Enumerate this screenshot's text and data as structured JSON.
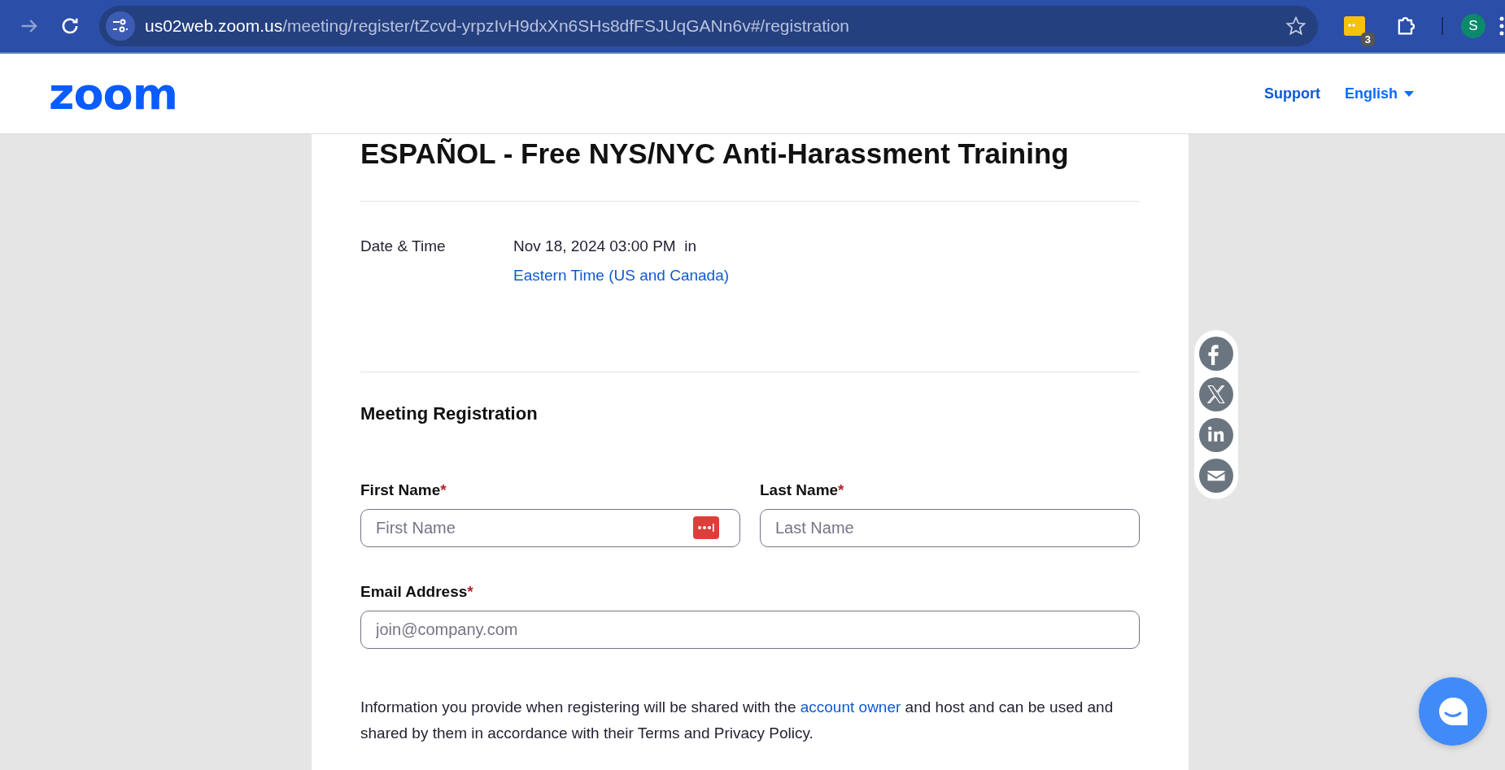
{
  "browser": {
    "url_host": "us02web.zoom.us",
    "url_path": "/meeting/register/tZcvd-yrpzIvH9dxXn6SHs8dfFSJUqGANn6v#/registration",
    "extension_badge": "3",
    "profile_initial": "S"
  },
  "header": {
    "logo": "zoom",
    "links": [
      {
        "label": "Support",
        "kind": "link"
      },
      {
        "label": "English",
        "kind": "dropdown"
      }
    ]
  },
  "meeting": {
    "title": "ESPAÑOL - Free NYS/NYC Anti-Harassment Training",
    "date_label": "Date & Time",
    "date_value": "Nov 18, 2024 03:00 PM  in",
    "timezone": "Eastern Time (US and Canada)"
  },
  "registration": {
    "heading": "Meeting Registration",
    "fields": [
      {
        "label": "First Name",
        "required_mark": "*",
        "placeholder": "First Name",
        "password_manager": true
      },
      {
        "label": "Last Name",
        "required_mark": "*",
        "placeholder": "Last Name",
        "password_manager": false
      },
      {
        "label": "Email Address",
        "required_mark": "*",
        "placeholder": "join@company.com",
        "password_manager": false
      }
    ],
    "notice_before": "Information you provide when registering will be shared with the ",
    "notice_link": "account owner",
    "notice_after": " and host and can be used and shared by them in accordance with their Terms and Privacy Policy."
  },
  "share": [
    {
      "kind": "facebook"
    },
    {
      "kind": "x"
    },
    {
      "kind": "linkedin"
    },
    {
      "kind": "email"
    }
  ]
}
